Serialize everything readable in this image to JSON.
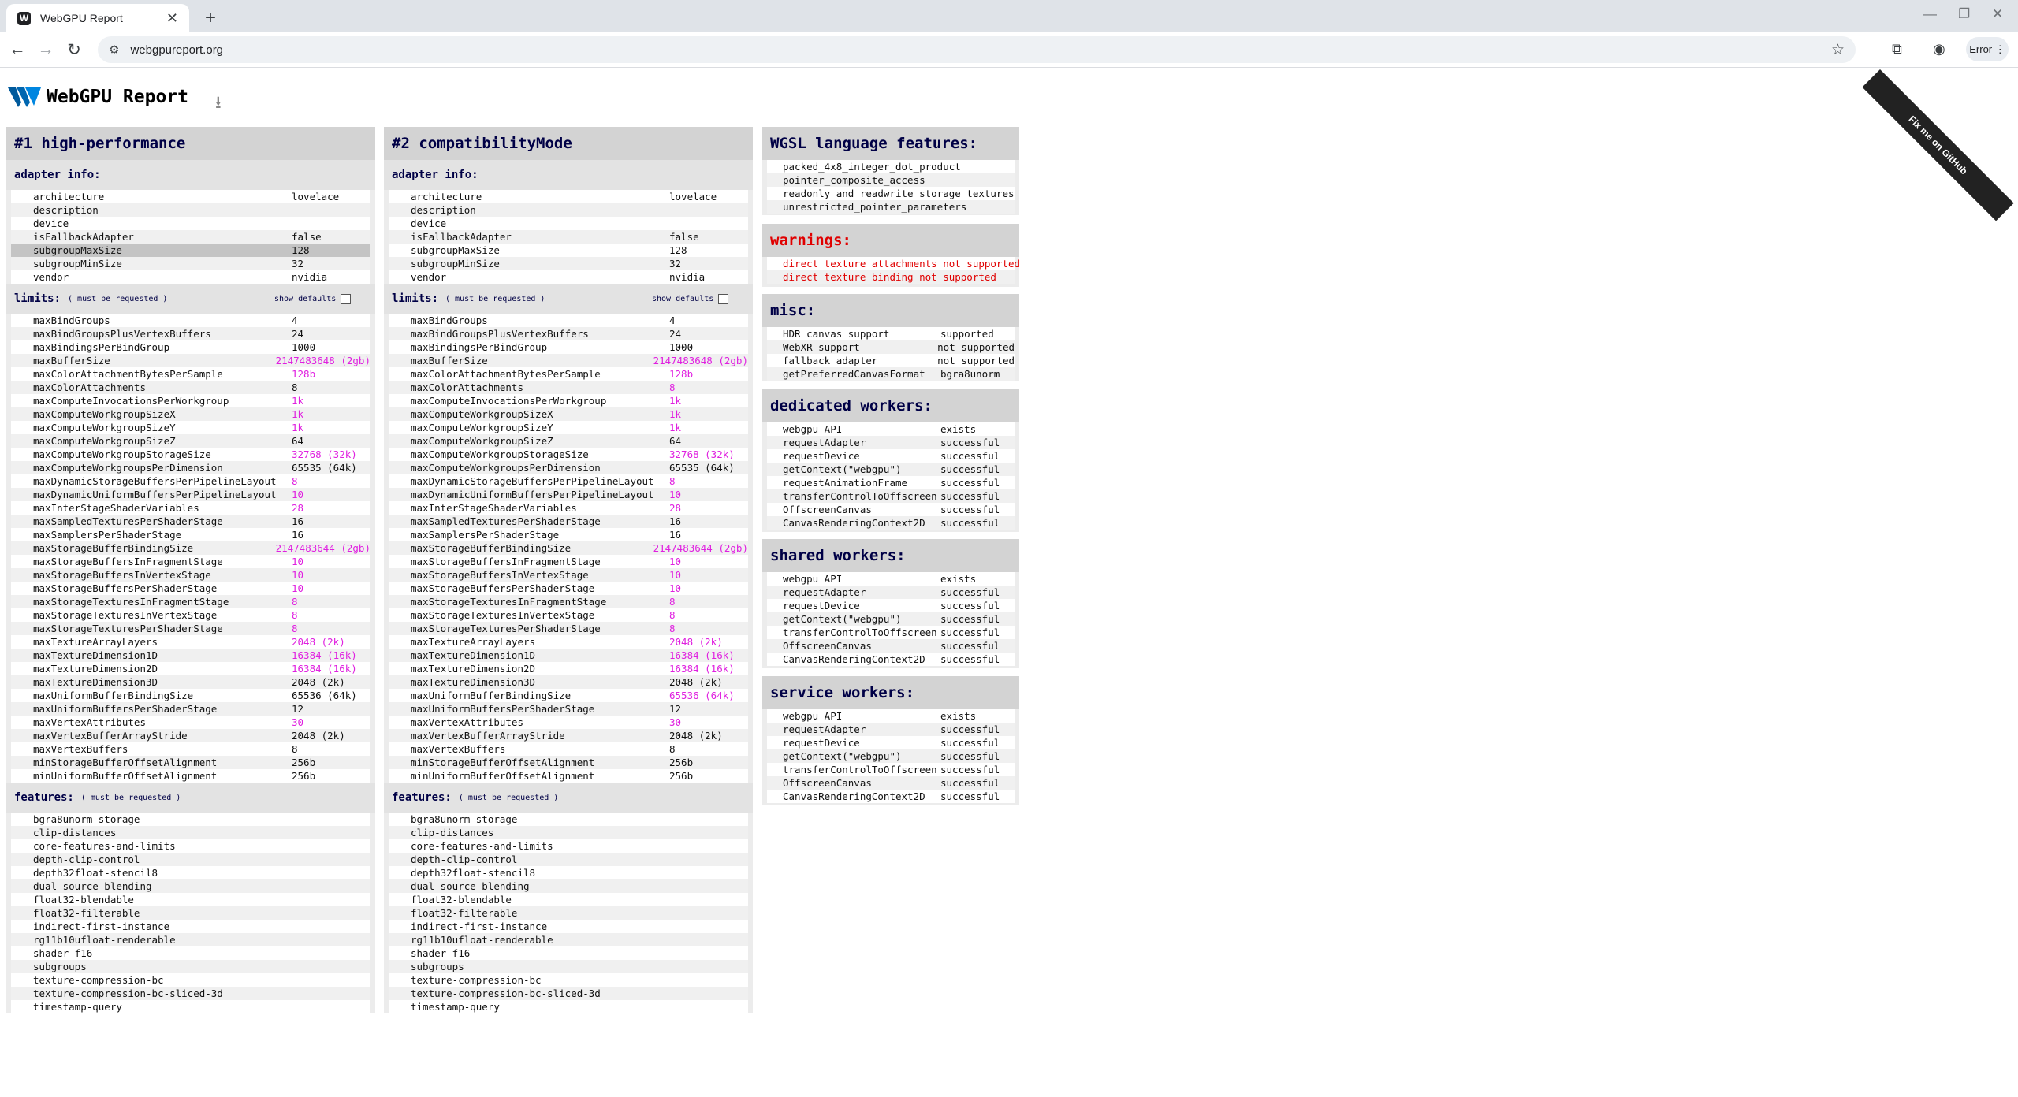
{
  "browser": {
    "tab_title": "WebGPU Report",
    "url": "webgpureport.org",
    "error_label": "Error"
  },
  "page": {
    "title": "WebGPU Report",
    "ribbon": "Fix me on GitHub"
  },
  "adapters": [
    {
      "title": "#1 high-performance",
      "adapter_info_label": "adapter info:",
      "adapter_info": [
        {
          "k": "architecture",
          "v": "lovelace"
        },
        {
          "k": "description",
          "v": ""
        },
        {
          "k": "device",
          "v": ""
        },
        {
          "k": "isFallbackAdapter",
          "v": "false"
        },
        {
          "k": "subgroupMaxSize",
          "v": "128",
          "selected": true
        },
        {
          "k": "subgroupMinSize",
          "v": "32"
        },
        {
          "k": "vendor",
          "v": "nvidia"
        }
      ],
      "limits_label": "limits:",
      "limits_req": "( must be requested )",
      "show_defaults": "show defaults",
      "limits": [
        {
          "k": "maxBindGroups",
          "v": "4"
        },
        {
          "k": "maxBindGroupsPlusVertexBuffers",
          "v": "24"
        },
        {
          "k": "maxBindingsPerBindGroup",
          "v": "1000"
        },
        {
          "k": "maxBufferSize",
          "v": "2147483648 (2gb)",
          "hl": true
        },
        {
          "k": "maxColorAttachmentBytesPerSample",
          "v": "128b",
          "hl": true
        },
        {
          "k": "maxColorAttachments",
          "v": "8"
        },
        {
          "k": "maxComputeInvocationsPerWorkgroup",
          "v": "1k",
          "hl": true
        },
        {
          "k": "maxComputeWorkgroupSizeX",
          "v": "1k",
          "hl": true
        },
        {
          "k": "maxComputeWorkgroupSizeY",
          "v": "1k",
          "hl": true
        },
        {
          "k": "maxComputeWorkgroupSizeZ",
          "v": "64"
        },
        {
          "k": "maxComputeWorkgroupStorageSize",
          "v": "32768 (32k)",
          "hl": true
        },
        {
          "k": "maxComputeWorkgroupsPerDimension",
          "v": "65535 (64k)"
        },
        {
          "k": "maxDynamicStorageBuffersPerPipelineLayout",
          "v": "8",
          "hl": true
        },
        {
          "k": "maxDynamicUniformBuffersPerPipelineLayout",
          "v": "10",
          "hl": true
        },
        {
          "k": "maxInterStageShaderVariables",
          "v": "28",
          "hl": true
        },
        {
          "k": "maxSampledTexturesPerShaderStage",
          "v": "16"
        },
        {
          "k": "maxSamplersPerShaderStage",
          "v": "16"
        },
        {
          "k": "maxStorageBufferBindingSize",
          "v": "2147483644 (2gb)",
          "hl": true
        },
        {
          "k": "maxStorageBuffersInFragmentStage",
          "v": "10",
          "hl": true
        },
        {
          "k": "maxStorageBuffersInVertexStage",
          "v": "10",
          "hl": true
        },
        {
          "k": "maxStorageBuffersPerShaderStage",
          "v": "10",
          "hl": true
        },
        {
          "k": "maxStorageTexturesInFragmentStage",
          "v": "8",
          "hl": true
        },
        {
          "k": "maxStorageTexturesInVertexStage",
          "v": "8",
          "hl": true
        },
        {
          "k": "maxStorageTexturesPerShaderStage",
          "v": "8",
          "hl": true
        },
        {
          "k": "maxTextureArrayLayers",
          "v": "2048 (2k)",
          "hl": true
        },
        {
          "k": "maxTextureDimension1D",
          "v": "16384 (16k)",
          "hl": true
        },
        {
          "k": "maxTextureDimension2D",
          "v": "16384 (16k)",
          "hl": true
        },
        {
          "k": "maxTextureDimension3D",
          "v": "2048 (2k)"
        },
        {
          "k": "maxUniformBufferBindingSize",
          "v": "65536 (64k)"
        },
        {
          "k": "maxUniformBuffersPerShaderStage",
          "v": "12"
        },
        {
          "k": "maxVertexAttributes",
          "v": "30",
          "hl": true
        },
        {
          "k": "maxVertexBufferArrayStride",
          "v": "2048 (2k)"
        },
        {
          "k": "maxVertexBuffers",
          "v": "8"
        },
        {
          "k": "minStorageBufferOffsetAlignment",
          "v": "256b"
        },
        {
          "k": "minUniformBufferOffsetAlignment",
          "v": "256b"
        }
      ],
      "features_label": "features:",
      "features_req": "( must be requested )",
      "features": [
        "bgra8unorm-storage",
        "clip-distances",
        "core-features-and-limits",
        "depth-clip-control",
        "depth32float-stencil8",
        "dual-source-blending",
        "float32-blendable",
        "float32-filterable",
        "indirect-first-instance",
        "rg11b10ufloat-renderable",
        "shader-f16",
        "subgroups",
        "texture-compression-bc",
        "texture-compression-bc-sliced-3d",
        "timestamp-query"
      ]
    },
    {
      "title": "#2 compatibilityMode",
      "adapter_info_label": "adapter info:",
      "adapter_info": [
        {
          "k": "architecture",
          "v": "lovelace"
        },
        {
          "k": "description",
          "v": ""
        },
        {
          "k": "device",
          "v": ""
        },
        {
          "k": "isFallbackAdapter",
          "v": "false"
        },
        {
          "k": "subgroupMaxSize",
          "v": "128"
        },
        {
          "k": "subgroupMinSize",
          "v": "32"
        },
        {
          "k": "vendor",
          "v": "nvidia"
        }
      ],
      "limits_label": "limits:",
      "limits_req": "( must be requested )",
      "show_defaults": "show defaults",
      "limits": [
        {
          "k": "maxBindGroups",
          "v": "4"
        },
        {
          "k": "maxBindGroupsPlusVertexBuffers",
          "v": "24"
        },
        {
          "k": "maxBindingsPerBindGroup",
          "v": "1000"
        },
        {
          "k": "maxBufferSize",
          "v": "2147483648 (2gb)",
          "hl": true
        },
        {
          "k": "maxColorAttachmentBytesPerSample",
          "v": "128b",
          "hl": true
        },
        {
          "k": "maxColorAttachments",
          "v": "8",
          "hl": true
        },
        {
          "k": "maxComputeInvocationsPerWorkgroup",
          "v": "1k",
          "hl": true
        },
        {
          "k": "maxComputeWorkgroupSizeX",
          "v": "1k",
          "hl": true
        },
        {
          "k": "maxComputeWorkgroupSizeY",
          "v": "1k",
          "hl": true
        },
        {
          "k": "maxComputeWorkgroupSizeZ",
          "v": "64"
        },
        {
          "k": "maxComputeWorkgroupStorageSize",
          "v": "32768 (32k)",
          "hl": true
        },
        {
          "k": "maxComputeWorkgroupsPerDimension",
          "v": "65535 (64k)"
        },
        {
          "k": "maxDynamicStorageBuffersPerPipelineLayout",
          "v": "8",
          "hl": true
        },
        {
          "k": "maxDynamicUniformBuffersPerPipelineLayout",
          "v": "10",
          "hl": true
        },
        {
          "k": "maxInterStageShaderVariables",
          "v": "28",
          "hl": true
        },
        {
          "k": "maxSampledTexturesPerShaderStage",
          "v": "16"
        },
        {
          "k": "maxSamplersPerShaderStage",
          "v": "16"
        },
        {
          "k": "maxStorageBufferBindingSize",
          "v": "2147483644 (2gb)",
          "hl": true
        },
        {
          "k": "maxStorageBuffersInFragmentStage",
          "v": "10",
          "hl": true
        },
        {
          "k": "maxStorageBuffersInVertexStage",
          "v": "10",
          "hl": true
        },
        {
          "k": "maxStorageBuffersPerShaderStage",
          "v": "10",
          "hl": true
        },
        {
          "k": "maxStorageTexturesInFragmentStage",
          "v": "8",
          "hl": true
        },
        {
          "k": "maxStorageTexturesInVertexStage",
          "v": "8",
          "hl": true
        },
        {
          "k": "maxStorageTexturesPerShaderStage",
          "v": "8",
          "hl": true
        },
        {
          "k": "maxTextureArrayLayers",
          "v": "2048 (2k)",
          "hl": true
        },
        {
          "k": "maxTextureDimension1D",
          "v": "16384 (16k)",
          "hl": true
        },
        {
          "k": "maxTextureDimension2D",
          "v": "16384 (16k)",
          "hl": true
        },
        {
          "k": "maxTextureDimension3D",
          "v": "2048 (2k)"
        },
        {
          "k": "maxUniformBufferBindingSize",
          "v": "65536 (64k)",
          "hl": true
        },
        {
          "k": "maxUniformBuffersPerShaderStage",
          "v": "12"
        },
        {
          "k": "maxVertexAttributes",
          "v": "30",
          "hl": true
        },
        {
          "k": "maxVertexBufferArrayStride",
          "v": "2048 (2k)"
        },
        {
          "k": "maxVertexBuffers",
          "v": "8"
        },
        {
          "k": "minStorageBufferOffsetAlignment",
          "v": "256b"
        },
        {
          "k": "minUniformBufferOffsetAlignment",
          "v": "256b"
        }
      ],
      "features_label": "features:",
      "features_req": "( must be requested )",
      "features": [
        "bgra8unorm-storage",
        "clip-distances",
        "core-features-and-limits",
        "depth-clip-control",
        "depth32float-stencil8",
        "dual-source-blending",
        "float32-blendable",
        "float32-filterable",
        "indirect-first-instance",
        "rg11b10ufloat-renderable",
        "shader-f16",
        "subgroups",
        "texture-compression-bc",
        "texture-compression-bc-sliced-3d",
        "timestamp-query"
      ]
    }
  ],
  "wgsl": {
    "title": "WGSL language features:",
    "items": [
      "packed_4x8_integer_dot_product",
      "pointer_composite_access",
      "readonly_and_readwrite_storage_textures",
      "unrestricted_pointer_parameters"
    ]
  },
  "warnings": {
    "title": "warnings:",
    "items": [
      "direct texture attachments not supported",
      "direct texture binding not supported"
    ]
  },
  "misc": {
    "title": "misc:",
    "rows": [
      {
        "k": "HDR canvas support",
        "v": "supported"
      },
      {
        "k": "WebXR support",
        "v": "not supported"
      },
      {
        "k": "fallback adapter",
        "v": "not supported"
      },
      {
        "k": "getPreferredCanvasFormat",
        "v": "bgra8unorm"
      }
    ]
  },
  "dedicated_workers": {
    "title": "dedicated workers:",
    "rows": [
      {
        "k": "webgpu API",
        "v": "exists"
      },
      {
        "k": "requestAdapter",
        "v": "successful"
      },
      {
        "k": "requestDevice",
        "v": "successful"
      },
      {
        "k": "getContext(\"webgpu\")",
        "v": "successful"
      },
      {
        "k": "requestAnimationFrame",
        "v": "successful"
      },
      {
        "k": "transferControlToOffscreen",
        "v": "successful"
      },
      {
        "k": "OffscreenCanvas",
        "v": "successful"
      },
      {
        "k": "CanvasRenderingContext2D",
        "v": "successful"
      }
    ]
  },
  "shared_workers": {
    "title": "shared workers:",
    "rows": [
      {
        "k": "webgpu API",
        "v": "exists"
      },
      {
        "k": "requestAdapter",
        "v": "successful"
      },
      {
        "k": "requestDevice",
        "v": "successful"
      },
      {
        "k": "getContext(\"webgpu\")",
        "v": "successful"
      },
      {
        "k": "transferControlToOffscreen",
        "v": "successful"
      },
      {
        "k": "OffscreenCanvas",
        "v": "successful"
      },
      {
        "k": "CanvasRenderingContext2D",
        "v": "successful"
      }
    ]
  },
  "service_workers": {
    "title": "service workers:",
    "rows": [
      {
        "k": "webgpu API",
        "v": "exists"
      },
      {
        "k": "requestAdapter",
        "v": "successful"
      },
      {
        "k": "requestDevice",
        "v": "successful"
      },
      {
        "k": "getContext(\"webgpu\")",
        "v": "successful"
      },
      {
        "k": "transferControlToOffscreen",
        "v": "successful"
      },
      {
        "k": "OffscreenCanvas",
        "v": "successful"
      },
      {
        "k": "CanvasRenderingContext2D",
        "v": "successful"
      }
    ]
  },
  "colors": {
    "highlight": "#e020e0",
    "heading": "#000046",
    "warning": "#e00000"
  }
}
